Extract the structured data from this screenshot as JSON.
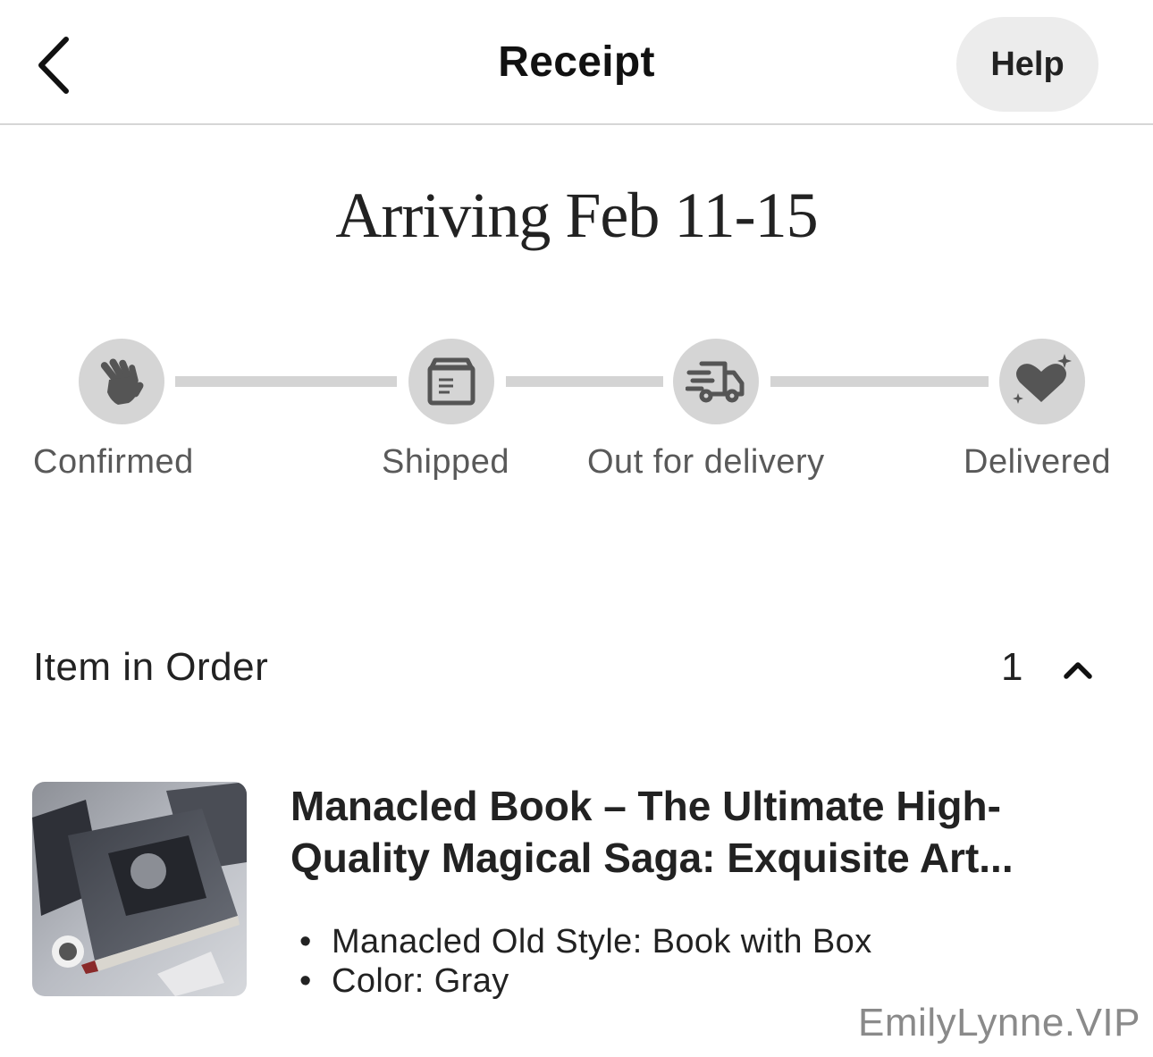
{
  "header": {
    "back_icon": "chevron-left-icon",
    "title": "Receipt",
    "help_label": "Help"
  },
  "delivery": {
    "arriving_text": "Arriving Feb 11-15",
    "steps": [
      {
        "label": "Confirmed",
        "icon": "waving-hand-icon"
      },
      {
        "label": "Shipped",
        "icon": "package-icon"
      },
      {
        "label": "Out for delivery",
        "icon": "delivery-truck-icon"
      },
      {
        "label": "Delivered",
        "icon": "sparkle-heart-icon"
      }
    ]
  },
  "order": {
    "section_title": "Item in Order",
    "count": "1",
    "toggle_icon": "chevron-up-icon",
    "item": {
      "title_line1": "Manacled Book – The Ultimate High-",
      "title_line2": "Quality Magical Saga: Exquisite Art...",
      "variants": [
        "Manacled Old Style: Book with Box",
        "Color: Gray"
      ]
    }
  },
  "watermark": "EmilyLynne.VIP",
  "colors": {
    "step_circle": "#d5d5d5",
    "track_line": "#d4d4d4",
    "icon": "#555555",
    "help_bg": "#ececec"
  }
}
